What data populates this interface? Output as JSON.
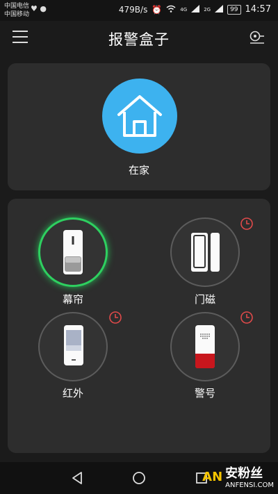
{
  "status_bar": {
    "carrier1": "中国电信",
    "carrier2": "中国移动",
    "speed": "479B/s",
    "battery": "99",
    "time": "14:57",
    "signal1": "4G",
    "signal2": "2G"
  },
  "header": {
    "title": "报警盒子",
    "menu_icon": "hamburger-menu-icon",
    "right_icon": "camera-settings-icon"
  },
  "home": {
    "label": "在家",
    "color": "#3db2ef",
    "icon": "house-icon"
  },
  "devices": [
    {
      "label": "幕帘",
      "icon": "curtain-sensor-icon",
      "active": true,
      "timer": false
    },
    {
      "label": "门磁",
      "icon": "door-magnet-icon",
      "active": false,
      "timer": true
    },
    {
      "label": "红外",
      "icon": "infrared-sensor-icon",
      "active": false,
      "timer": true
    },
    {
      "label": "警号",
      "icon": "siren-icon",
      "active": false,
      "timer": true
    }
  ],
  "colors": {
    "accent_blue": "#3db2ef",
    "active_green": "#2ed060",
    "timer_red": "#e04a4a",
    "siren_red": "#c8161d"
  },
  "watermark": {
    "logo": "AN",
    "name": "安粉丝",
    "site": "ANFENSI.COM"
  }
}
